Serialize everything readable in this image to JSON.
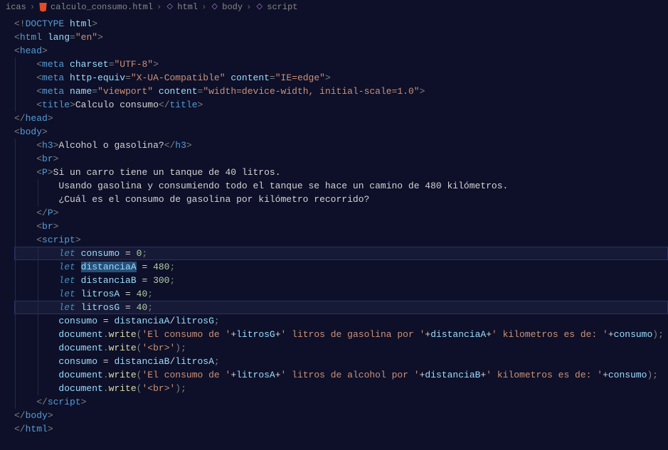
{
  "breadcrumb": {
    "path_prefix": "icas",
    "file": "calculo_consumo.html",
    "segments": [
      "html",
      "body",
      "script"
    ]
  },
  "code": {
    "lines": [
      {
        "i": 0,
        "tokens": [
          {
            "t": "<!",
            "c": "tok-punct"
          },
          {
            "t": "DOCTYPE",
            "c": "tok-doctype"
          },
          {
            "t": " html",
            "c": "tok-attr"
          },
          {
            "t": ">",
            "c": "tok-punct"
          }
        ]
      },
      {
        "i": 0,
        "tokens": [
          {
            "t": "<",
            "c": "tok-punct"
          },
          {
            "t": "html",
            "c": "tok-tag"
          },
          {
            "t": " lang",
            "c": "tok-attr"
          },
          {
            "t": "=",
            "c": "tok-punct"
          },
          {
            "t": "\"en\"",
            "c": "tok-string"
          },
          {
            "t": ">",
            "c": "tok-punct"
          }
        ]
      },
      {
        "i": 0,
        "tokens": [
          {
            "t": "<",
            "c": "tok-punct"
          },
          {
            "t": "head",
            "c": "tok-tag"
          },
          {
            "t": ">",
            "c": "tok-punct"
          }
        ]
      },
      {
        "i": 1,
        "tokens": [
          {
            "t": "<",
            "c": "tok-punct"
          },
          {
            "t": "meta",
            "c": "tok-tag"
          },
          {
            "t": " charset",
            "c": "tok-attr"
          },
          {
            "t": "=",
            "c": "tok-punct"
          },
          {
            "t": "\"UTF-8\"",
            "c": "tok-string"
          },
          {
            "t": ">",
            "c": "tok-punct"
          }
        ]
      },
      {
        "i": 1,
        "tokens": [
          {
            "t": "<",
            "c": "tok-punct"
          },
          {
            "t": "meta",
            "c": "tok-tag"
          },
          {
            "t": " http-equiv",
            "c": "tok-attr"
          },
          {
            "t": "=",
            "c": "tok-punct"
          },
          {
            "t": "\"X-UA-Compatible\"",
            "c": "tok-string"
          },
          {
            "t": " content",
            "c": "tok-attr"
          },
          {
            "t": "=",
            "c": "tok-punct"
          },
          {
            "t": "\"IE=edge\"",
            "c": "tok-string"
          },
          {
            "t": ">",
            "c": "tok-punct"
          }
        ]
      },
      {
        "i": 1,
        "tokens": [
          {
            "t": "<",
            "c": "tok-punct"
          },
          {
            "t": "meta",
            "c": "tok-tag"
          },
          {
            "t": " name",
            "c": "tok-attr"
          },
          {
            "t": "=",
            "c": "tok-punct"
          },
          {
            "t": "\"viewport\"",
            "c": "tok-string"
          },
          {
            "t": " content",
            "c": "tok-attr"
          },
          {
            "t": "=",
            "c": "tok-punct"
          },
          {
            "t": "\"width=device-width, initial-scale=1.0\"",
            "c": "tok-string"
          },
          {
            "t": ">",
            "c": "tok-punct"
          }
        ]
      },
      {
        "i": 1,
        "tokens": [
          {
            "t": "<",
            "c": "tok-punct"
          },
          {
            "t": "title",
            "c": "tok-tag"
          },
          {
            "t": ">",
            "c": "tok-punct"
          },
          {
            "t": "Calculo consumo",
            "c": "tok-text"
          },
          {
            "t": "</",
            "c": "tok-punct"
          },
          {
            "t": "title",
            "c": "tok-tag"
          },
          {
            "t": ">",
            "c": "tok-punct"
          }
        ]
      },
      {
        "i": 0,
        "tokens": [
          {
            "t": "</",
            "c": "tok-punct"
          },
          {
            "t": "head",
            "c": "tok-tag"
          },
          {
            "t": ">",
            "c": "tok-punct"
          }
        ]
      },
      {
        "i": 0,
        "tokens": [
          {
            "t": "<",
            "c": "tok-punct"
          },
          {
            "t": "body",
            "c": "tok-tag"
          },
          {
            "t": ">",
            "c": "tok-punct"
          }
        ]
      },
      {
        "i": 1,
        "tokens": [
          {
            "t": "<",
            "c": "tok-punct"
          },
          {
            "t": "h3",
            "c": "tok-tag"
          },
          {
            "t": ">",
            "c": "tok-punct"
          },
          {
            "t": "Alcohol o gasolina?",
            "c": "tok-text"
          },
          {
            "t": "</",
            "c": "tok-punct"
          },
          {
            "t": "h3",
            "c": "tok-tag"
          },
          {
            "t": ">",
            "c": "tok-punct"
          }
        ]
      },
      {
        "i": 1,
        "tokens": [
          {
            "t": "<",
            "c": "tok-punct"
          },
          {
            "t": "br",
            "c": "tok-tag"
          },
          {
            "t": ">",
            "c": "tok-punct"
          }
        ]
      },
      {
        "i": 1,
        "tokens": [
          {
            "t": "<",
            "c": "tok-punct"
          },
          {
            "t": "P",
            "c": "tok-tag"
          },
          {
            "t": ">",
            "c": "tok-punct"
          },
          {
            "t": "Si un carro tiene un tanque de 40 litros.",
            "c": "tok-text"
          }
        ]
      },
      {
        "i": 2,
        "tokens": [
          {
            "t": "Usando gasolina y consumiendo todo el tanque se hace un camino de 480 kilómetros.",
            "c": "tok-text"
          }
        ]
      },
      {
        "i": 2,
        "tokens": [
          {
            "t": "¿Cuál es el consumo de gasolina por kilómetro recorrido?",
            "c": "tok-text"
          }
        ]
      },
      {
        "i": 1,
        "tokens": [
          {
            "t": "</",
            "c": "tok-punct"
          },
          {
            "t": "P",
            "c": "tok-tag"
          },
          {
            "t": ">",
            "c": "tok-punct"
          }
        ]
      },
      {
        "i": 1,
        "tokens": [
          {
            "t": "<",
            "c": "tok-punct"
          },
          {
            "t": "br",
            "c": "tok-tag"
          },
          {
            "t": ">",
            "c": "tok-punct"
          }
        ]
      },
      {
        "i": 1,
        "tokens": [
          {
            "t": "<",
            "c": "tok-punct"
          },
          {
            "t": "script",
            "c": "tok-tag"
          },
          {
            "t": ">",
            "c": "tok-punct"
          }
        ]
      },
      {
        "i": 2,
        "hl": true,
        "tokens": [
          {
            "t": "let",
            "c": "tok-let"
          },
          {
            "t": " consumo",
            "c": "tok-var"
          },
          {
            "t": " = ",
            "c": "tok-op"
          },
          {
            "t": "0",
            "c": "tok-num"
          },
          {
            "t": ";",
            "c": "tok-punct"
          }
        ]
      },
      {
        "i": 2,
        "tokens": [
          {
            "t": "let",
            "c": "tok-let"
          },
          {
            "t": " ",
            "c": ""
          },
          {
            "t": "distanciaA",
            "c": "tok-var",
            "sel": true
          },
          {
            "t": " = ",
            "c": "tok-op"
          },
          {
            "t": "480",
            "c": "tok-num"
          },
          {
            "t": ";",
            "c": "tok-punct"
          }
        ]
      },
      {
        "i": 2,
        "tokens": [
          {
            "t": "let",
            "c": "tok-let"
          },
          {
            "t": " distanciaB",
            "c": "tok-var"
          },
          {
            "t": " = ",
            "c": "tok-op"
          },
          {
            "t": "300",
            "c": "tok-num"
          },
          {
            "t": ";",
            "c": "tok-punct"
          }
        ]
      },
      {
        "i": 2,
        "tokens": [
          {
            "t": "let",
            "c": "tok-let"
          },
          {
            "t": " litrosA",
            "c": "tok-var"
          },
          {
            "t": " = ",
            "c": "tok-op"
          },
          {
            "t": "40",
            "c": "tok-num"
          },
          {
            "t": ";",
            "c": "tok-punct"
          }
        ]
      },
      {
        "i": 2,
        "hl": true,
        "tokens": [
          {
            "t": "let",
            "c": "tok-let"
          },
          {
            "t": " litrosG",
            "c": "tok-var"
          },
          {
            "t": " = ",
            "c": "tok-op"
          },
          {
            "t": "40",
            "c": "tok-num"
          },
          {
            "t": ";",
            "c": "tok-punct"
          }
        ]
      },
      {
        "i": 2,
        "tokens": [
          {
            "t": "consumo",
            "c": "tok-var"
          },
          {
            "t": " = ",
            "c": "tok-op"
          },
          {
            "t": "distanciaA",
            "c": "tok-var"
          },
          {
            "t": "/",
            "c": "tok-op"
          },
          {
            "t": "litrosG",
            "c": "tok-var"
          },
          {
            "t": ";",
            "c": "tok-punct"
          }
        ]
      },
      {
        "i": 2,
        "tokens": [
          {
            "t": "document",
            "c": "tok-obj"
          },
          {
            "t": ".",
            "c": "tok-punct"
          },
          {
            "t": "write",
            "c": "tok-method"
          },
          {
            "t": "(",
            "c": "tok-punct"
          },
          {
            "t": "'El consumo de '",
            "c": "tok-strlit"
          },
          {
            "t": "+",
            "c": "tok-op"
          },
          {
            "t": "litrosG",
            "c": "tok-var"
          },
          {
            "t": "+",
            "c": "tok-op"
          },
          {
            "t": "' litros de gasolina por '",
            "c": "tok-strlit"
          },
          {
            "t": "+",
            "c": "tok-op"
          },
          {
            "t": "distanciaA",
            "c": "tok-var"
          },
          {
            "t": "+",
            "c": "tok-op"
          },
          {
            "t": "' kilometros es de: '",
            "c": "tok-strlit"
          },
          {
            "t": "+",
            "c": "tok-op"
          },
          {
            "t": "consumo",
            "c": "tok-var"
          },
          {
            "t": ");",
            "c": "tok-punct"
          }
        ]
      },
      {
        "i": 2,
        "tokens": [
          {
            "t": "document",
            "c": "tok-obj"
          },
          {
            "t": ".",
            "c": "tok-punct"
          },
          {
            "t": "write",
            "c": "tok-method"
          },
          {
            "t": "(",
            "c": "tok-punct"
          },
          {
            "t": "'<br>'",
            "c": "tok-strlit"
          },
          {
            "t": ");",
            "c": "tok-punct"
          }
        ]
      },
      {
        "i": 2,
        "tokens": [
          {
            "t": "consumo",
            "c": "tok-var"
          },
          {
            "t": " = ",
            "c": "tok-op"
          },
          {
            "t": "distanciaB",
            "c": "tok-var"
          },
          {
            "t": "/",
            "c": "tok-op"
          },
          {
            "t": "litrosA",
            "c": "tok-var"
          },
          {
            "t": ";",
            "c": "tok-punct"
          }
        ]
      },
      {
        "i": 2,
        "tokens": [
          {
            "t": "document",
            "c": "tok-obj"
          },
          {
            "t": ".",
            "c": "tok-punct"
          },
          {
            "t": "write",
            "c": "tok-method"
          },
          {
            "t": "(",
            "c": "tok-punct"
          },
          {
            "t": "'El consumo de '",
            "c": "tok-strlit"
          },
          {
            "t": "+",
            "c": "tok-op"
          },
          {
            "t": "litrosA",
            "c": "tok-var"
          },
          {
            "t": "+",
            "c": "tok-op"
          },
          {
            "t": "' litros de alcohol por '",
            "c": "tok-strlit"
          },
          {
            "t": "+",
            "c": "tok-op"
          },
          {
            "t": "distanciaB",
            "c": "tok-var"
          },
          {
            "t": "+",
            "c": "tok-op"
          },
          {
            "t": "' kilometros es de: '",
            "c": "tok-strlit"
          },
          {
            "t": "+",
            "c": "tok-op"
          },
          {
            "t": "consumo",
            "c": "tok-var"
          },
          {
            "t": ");",
            "c": "tok-punct"
          }
        ]
      },
      {
        "i": 2,
        "tokens": [
          {
            "t": "document",
            "c": "tok-obj"
          },
          {
            "t": ".",
            "c": "tok-punct"
          },
          {
            "t": "write",
            "c": "tok-method"
          },
          {
            "t": "(",
            "c": "tok-punct"
          },
          {
            "t": "'<br>'",
            "c": "tok-strlit"
          },
          {
            "t": ");",
            "c": "tok-punct"
          }
        ]
      },
      {
        "i": 1,
        "tokens": [
          {
            "t": "</",
            "c": "tok-punct"
          },
          {
            "t": "script",
            "c": "tok-tag"
          },
          {
            "t": ">",
            "c": "tok-punct"
          }
        ]
      },
      {
        "i": 0,
        "tokens": [
          {
            "t": "</",
            "c": "tok-punct"
          },
          {
            "t": "body",
            "c": "tok-tag"
          },
          {
            "t": ">",
            "c": "tok-punct"
          }
        ]
      },
      {
        "i": 0,
        "tokens": [
          {
            "t": "</",
            "c": "tok-punct"
          },
          {
            "t": "html",
            "c": "tok-tag"
          },
          {
            "t": ">",
            "c": "tok-punct"
          }
        ]
      }
    ]
  }
}
